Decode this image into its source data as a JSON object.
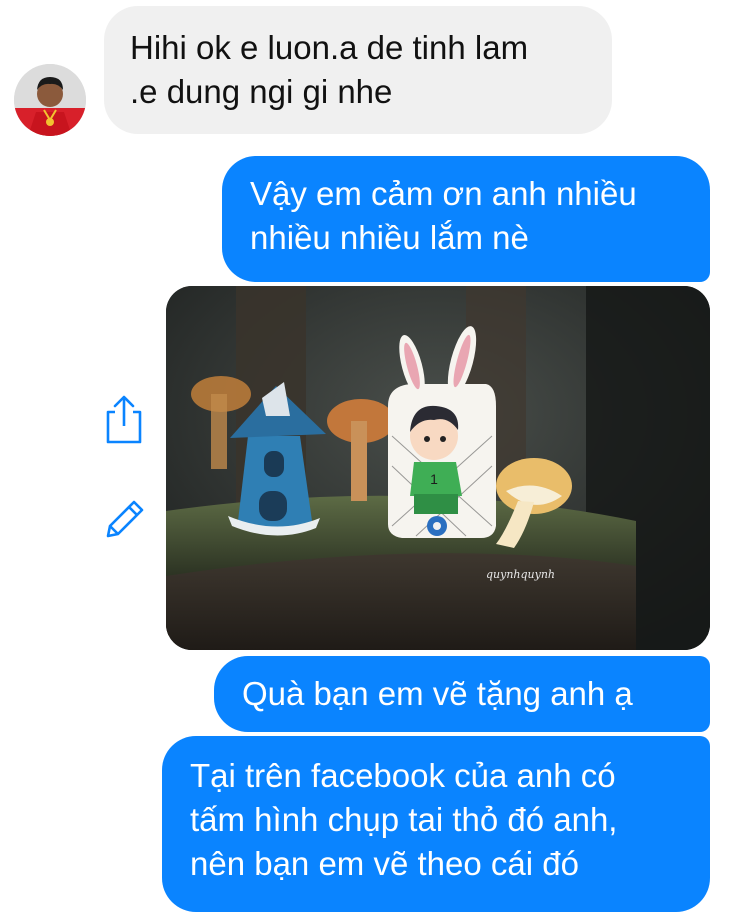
{
  "incoming": {
    "avatar_icon": "person-avatar",
    "messages": [
      {
        "text": "Hihi ok e luon.a de tinh lam\n.e dung ngi gi nhe"
      }
    ]
  },
  "outgoing": {
    "messages": [
      {
        "text": "Vậy em cảm ơn anh nhiều\nnhiều nhiều lắm nè"
      },
      {
        "text": "Quà bạn em vẽ tặng anh ạ"
      },
      {
        "text": "Tại trên facebook của anh có\ntấm hình chụp tai thỏ đó anh,\nnên bạn em vẽ theo cái đó"
      }
    ],
    "photo": {
      "icon": "photo-attachment",
      "watermark": "quynhquynh",
      "jersey_number": "1"
    }
  },
  "actions": {
    "share_icon": "share-icon",
    "edit_icon": "pencil-icon"
  },
  "colors": {
    "outgoing_bubble": "#0a84ff",
    "incoming_bubble": "#f0f0f0",
    "action_icon": "#0a84ff"
  }
}
